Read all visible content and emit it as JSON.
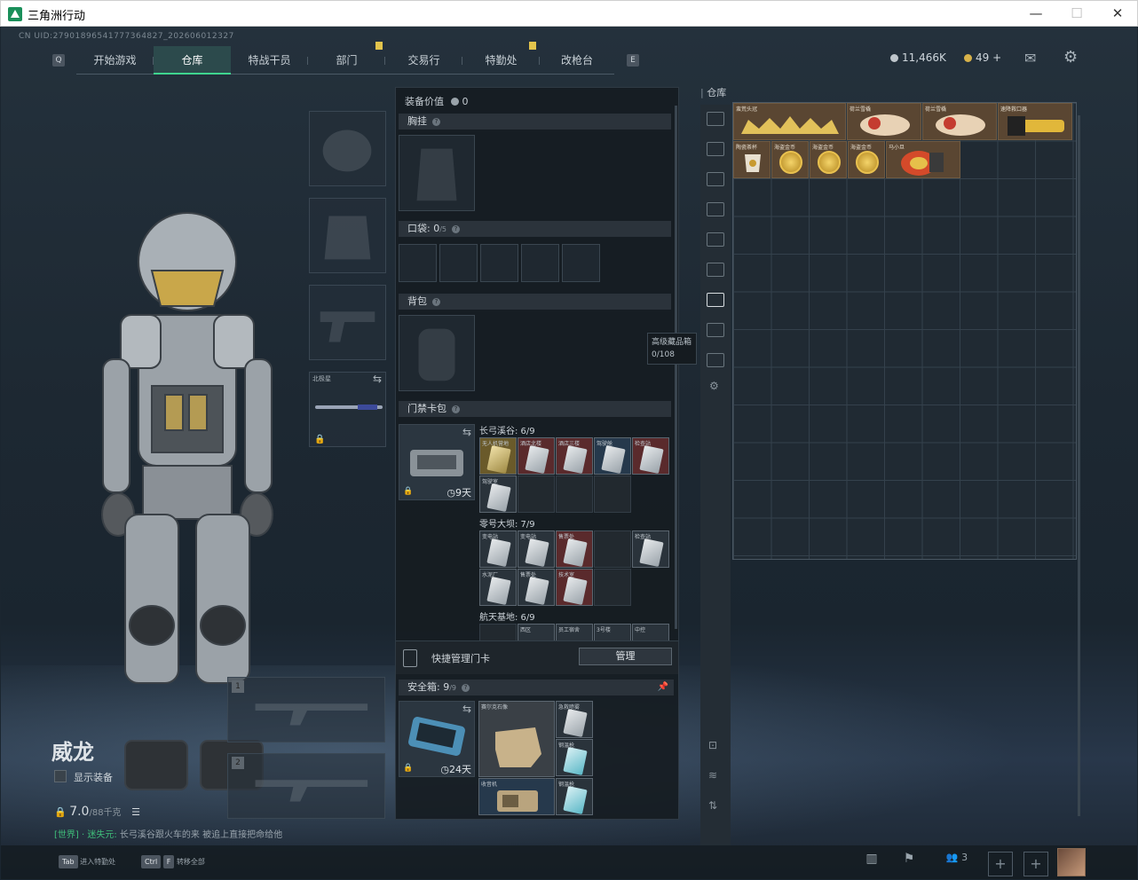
{
  "window": {
    "title": "三角洲行动",
    "minimize": "—",
    "maximize": "☐",
    "close": "✕"
  },
  "uid": "CN UID:2790189654177736482​7_202606012327",
  "nav": {
    "tabs": [
      "开始游戏",
      "仓库",
      "特战干员",
      "部门",
      "交易行",
      "特勤处",
      "改枪台"
    ],
    "active": "仓库"
  },
  "currency": {
    "silver": "11,466K",
    "gold": "49",
    "plus": "+"
  },
  "operator": {
    "name": "威龙",
    "show_gear_label": "显示装备",
    "weight": "7.0",
    "weight_max": "/88千克"
  },
  "chat": {
    "channel": "[世界]",
    "user": "· 迷失元:",
    "message": "长弓溪谷跟火车的来 被追上直接把命给他"
  },
  "equip": {
    "value_label": "装备价值",
    "value": "0",
    "chest": "胸挂",
    "pocket_label": "口袋:",
    "pocket_count": "0",
    "pocket_max": "/5",
    "backpack": "背包",
    "keycard_bag": "门禁卡包",
    "melee_label": "北极星",
    "kc_days": "9天",
    "zone1": {
      "name": "长弓溪谷: 6/9",
      "cards": [
        "无人机营地",
        "酒店北楼",
        "酒店三楼",
        "驾驶舱",
        "检查站",
        "驾驶室"
      ]
    },
    "zone2": {
      "name": "零号大坝: 7/9",
      "cards": [
        "变电站",
        "变电站",
        "售票处",
        "",
        "检查站",
        "水泥厂",
        "售票处",
        "技术室"
      ]
    },
    "zone3": {
      "name": "航天基地: 6/9",
      "cards": [
        "西区",
        "员工宿舍",
        "3号楼",
        "中控"
      ]
    },
    "quick_manage": "快捷管理门卡",
    "manage_btn": "管理",
    "safebox_label": "安全箱:",
    "safebox_count": "9",
    "safebox_max": "/9",
    "safe_days": "24天",
    "safe_items": [
      "赛尔克石像",
      "急救喷雾",
      "钢温枪",
      "收音机",
      "钢温枪"
    ]
  },
  "warehouse": {
    "title": "仓库",
    "tooltip_name": "高级藏品箱",
    "tooltip_cap": "0/108",
    "items": [
      "蛮荒头冠",
      "荷兰雪橇",
      "荷兰雪橇",
      "速降救口器",
      "陶瓷茶杯",
      "海盗金币",
      "海盗金币",
      "海盗金币",
      "马小旦"
    ]
  },
  "bottom": {
    "tab_key": "Tab",
    "tab_label": "进入特勤处",
    "ctrl_key": "Ctrl",
    "f_key": "F",
    "transfer_label": "转移全部",
    "friends_count": "3"
  },
  "colors": {
    "accent": "#3fd58f",
    "gold": "#e3c44c",
    "panel": "#2b333b"
  }
}
